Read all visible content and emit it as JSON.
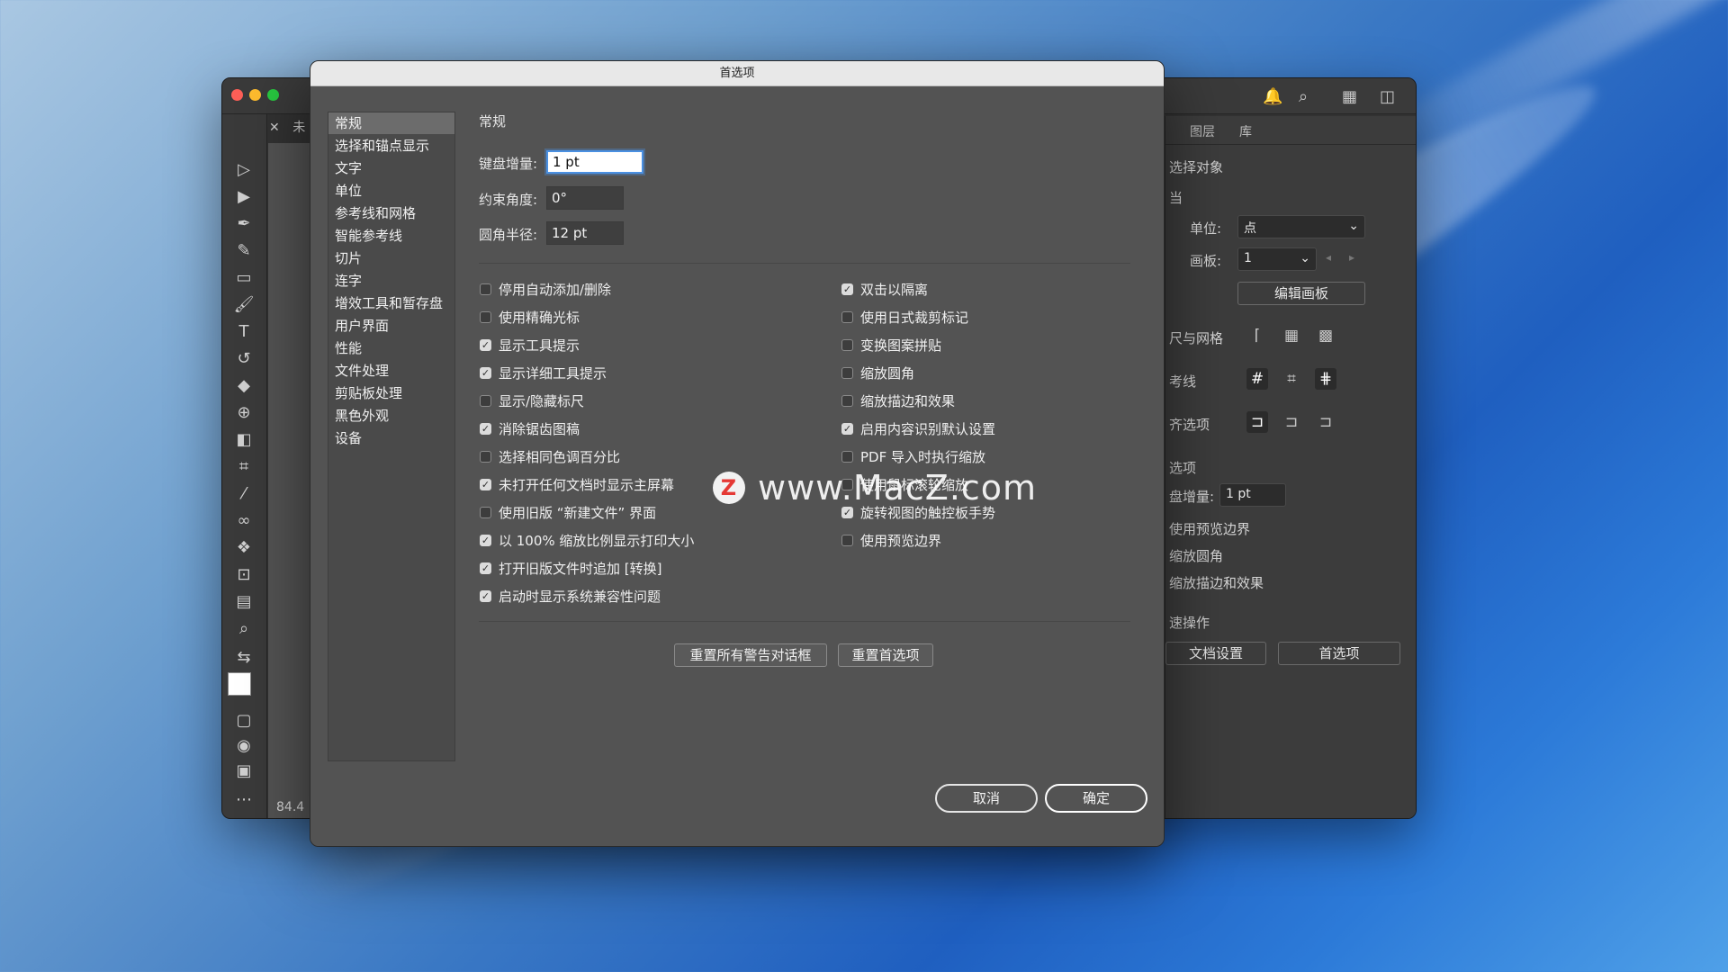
{
  "dialog": {
    "title": "首选项",
    "categories": [
      "常规",
      "选择和锚点显示",
      "文字",
      "单位",
      "参考线和网格",
      "智能参考线",
      "切片",
      "连字",
      "增效工具和暂存盘",
      "用户界面",
      "性能",
      "文件处理",
      "剪贴板处理",
      "黑色外观",
      "设备"
    ],
    "active_category": "常规",
    "section_title": "常规",
    "fields": [
      {
        "label": "键盘增量:",
        "value": "1 pt"
      },
      {
        "label": "约束角度:",
        "value": "0°"
      },
      {
        "label": "圆角半径:",
        "value": "12 pt"
      }
    ],
    "left_checkboxes": [
      {
        "label": "停用自动添加/删除",
        "checked": false
      },
      {
        "label": "使用精确光标",
        "checked": false
      },
      {
        "label": "显示工具提示",
        "checked": true
      },
      {
        "label": "显示详细工具提示",
        "checked": true
      },
      {
        "label": "显示/隐藏标尺",
        "checked": false
      },
      {
        "label": "消除锯齿图稿",
        "checked": true
      },
      {
        "label": "选择相同色调百分比",
        "checked": false
      },
      {
        "label": "未打开任何文档时显示主屏幕",
        "checked": true
      },
      {
        "label": "使用旧版 “新建文件” 界面",
        "checked": false
      },
      {
        "label": "以 100% 缩放比例显示打印大小",
        "checked": true
      },
      {
        "label": "打开旧版文件时追加 [转换]",
        "checked": true
      },
      {
        "label": "启动时显示系统兼容性问题",
        "checked": true
      }
    ],
    "right_checkboxes": [
      {
        "label": "双击以隔离",
        "checked": true
      },
      {
        "label": "使用日式裁剪标记",
        "checked": false
      },
      {
        "label": "变换图案拼贴",
        "checked": false
      },
      {
        "label": "缩放圆角",
        "checked": false
      },
      {
        "label": "缩放描边和效果",
        "checked": false
      },
      {
        "label": "启用内容识别默认设置",
        "checked": true
      },
      {
        "label": "PDF 导入时执行缩放",
        "checked": false
      },
      {
        "label": "使用鼠标滚轮缩放",
        "checked": false
      },
      {
        "label": "旋转视图的触控板手势",
        "checked": true
      },
      {
        "label": "使用预览边界",
        "checked": false
      }
    ],
    "reset_warnings_label": "重置所有警告对话框",
    "reset_prefs_label": "重置首选项",
    "cancel_label": "取消",
    "ok_label": "确定"
  },
  "app": {
    "doc_tab_label": "未",
    "zoom_readout": "84.4",
    "panel_tabs": [
      "图层",
      "库"
    ],
    "panel": {
      "no_selection": "选择对象",
      "doc_header": "当",
      "unit_label": "单位:",
      "unit_value": "点",
      "artboard_label": "画板:",
      "artboard_value": "1",
      "edit_artboard": "编辑画板",
      "rulers_grids": "尺与网格",
      "guides": "考线",
      "snap_options": "齐选项",
      "prefs_header": "选项",
      "keyboard_increment_label": "盘增量:",
      "keyboard_increment_value": "1 pt",
      "preview_bounds": "使用预览边界",
      "scale_corners": "缩放圆角",
      "scale_strokes": "缩放描边和效果",
      "quick_actions": "速操作",
      "doc_setup": "文档设置",
      "preferences": "首选项"
    }
  },
  "watermark": {
    "logo_letter": "Z",
    "text": "www.MacZ.com"
  }
}
